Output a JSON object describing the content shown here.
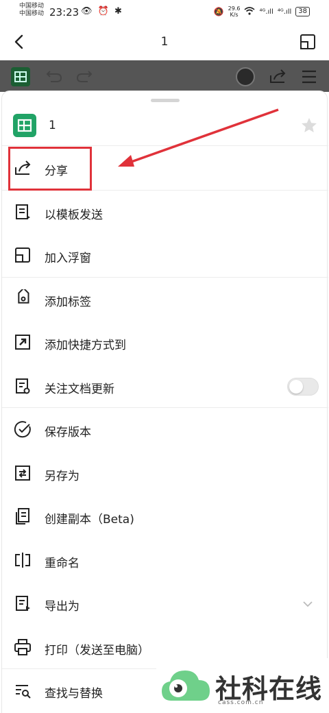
{
  "status_bar": {
    "carrier_1": "中国移动",
    "carrier_2": "中国移动",
    "time": "23:23",
    "left_icons": "👁 ⏰ ✱",
    "net_speed_value": "29.6",
    "net_speed_unit": "K/s",
    "signal_1": "⁴ᴳ.ıll",
    "signal_2": "⁴ᴳ.ıll",
    "battery": "38"
  },
  "nav": {
    "title": "1"
  },
  "sheet": {
    "doc_title": "1"
  },
  "menu_items": [
    {
      "label": "分享",
      "icon": "share-icon"
    },
    {
      "label": "以模板发送",
      "icon": "template-send-icon"
    },
    {
      "label": "加入浮窗",
      "icon": "floating-window-icon"
    },
    {
      "label": "添加标签",
      "icon": "tag-icon"
    },
    {
      "label": "添加快捷方式到",
      "icon": "shortcut-icon"
    },
    {
      "label": "关注文档更新",
      "icon": "watch-doc-icon"
    },
    {
      "label": "保存版本",
      "icon": "check-circle-icon"
    },
    {
      "label": "另存为",
      "icon": "save-as-icon"
    },
    {
      "label": "创建副本（Beta)",
      "icon": "copy-icon"
    },
    {
      "label": "重命名",
      "icon": "rename-icon"
    },
    {
      "label": "导出为",
      "icon": "export-icon"
    },
    {
      "label": "打印（发送至电脑）",
      "icon": "print-icon"
    },
    {
      "label": "查找与替换",
      "icon": "find-replace-icon"
    }
  ],
  "toggle_watch": {
    "on": false
  },
  "watermark": {
    "name": "社科在线",
    "url": "cass.com.cn"
  },
  "colors": {
    "toolbar": "#555555",
    "sheet_icon": "#21a366",
    "annotation": "#e0323a"
  }
}
